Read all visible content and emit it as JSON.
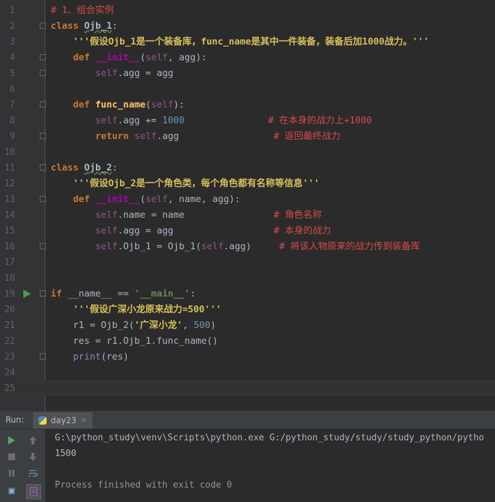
{
  "editor": {
    "lines": [
      {
        "n": "1",
        "html": "<span class='cm'># 1、组合实例</span>"
      },
      {
        "n": "2",
        "html": "<span class='kw'>class</span> <span class='cls'>Ojb_1</span>:"
      },
      {
        "n": "3",
        "html": "    <span class='docstr'>'''假设Ojb_1是一个装备库，func_name是其中一件装备，装备后加1000战力。'''</span>"
      },
      {
        "n": "4",
        "html": "    <span class='kw'>def</span> <span class='dunder'>__init__</span>(<span class='self'>self</span>, agg):"
      },
      {
        "n": "5",
        "html": "        <span class='self'>self</span>.agg = agg"
      },
      {
        "n": "6",
        "html": ""
      },
      {
        "n": "7",
        "html": "    <span class='kw'>def</span> <span class='fn'>func_name</span>(<span class='self'>self</span>):"
      },
      {
        "n": "8",
        "html": "        <span class='self'>self</span>.agg += <span class='num'>1000</span>               <span class='cm'># 在本身的战力上+1000</span>"
      },
      {
        "n": "9",
        "html": "        <span class='kw'>return</span> <span class='self'>self</span>.agg                 <span class='cm'># 返回最终战力</span>"
      },
      {
        "n": "10",
        "html": ""
      },
      {
        "n": "11",
        "html": "<span class='kw'>class</span> <span class='cls'>Ojb_2</span>:"
      },
      {
        "n": "12",
        "html": "    <span class='docstr'>'''假设Ojb_2是一个角色类，每个角色都有名称等信息'''</span>"
      },
      {
        "n": "13",
        "html": "    <span class='kw'>def</span> <span class='dunder'>__init__</span>(<span class='self'>self</span>, name, agg):"
      },
      {
        "n": "14",
        "html": "        <span class='self'>self</span>.name = name                <span class='cm'># 角色名称</span>"
      },
      {
        "n": "15",
        "html": "        <span class='self'>self</span>.agg = agg                  <span class='cm'># 本身的战力</span>"
      },
      {
        "n": "16",
        "html": "        <span class='self'>self</span>.Ojb_1 = Ojb_1(<span class='self'>self</span>.agg)     <span class='cm'># 将该人物原来的战力传到装备库</span>"
      },
      {
        "n": "17",
        "html": ""
      },
      {
        "n": "18",
        "html": ""
      },
      {
        "n": "19",
        "html": "<span class='kw'>if</span> __name__ == <span class='str'>'__main__'</span>:"
      },
      {
        "n": "20",
        "html": "    <span class='docstr'>'''假设广深小龙原来战力=500'''</span>"
      },
      {
        "n": "21",
        "html": "    r1 = Ojb_2(<span class='docstr'>'广深小龙'</span>, <span class='num'>500</span>)"
      },
      {
        "n": "22",
        "html": "    res = r1.Ojb_1.func_name()"
      },
      {
        "n": "23",
        "html": "    <span class='kw' style='font-weight:normal;color:#8888c6'>print</span>(res)"
      },
      {
        "n": "24",
        "html": ""
      },
      {
        "n": "25",
        "html": ""
      }
    ]
  },
  "run": {
    "label": "Run:",
    "tab_name": "day23",
    "close": "×",
    "command": "G:\\python_study\\venv\\Scripts\\python.exe G:/python_study/study/study_python/pytho",
    "output": "1500",
    "exit": "Process finished with exit code 0"
  }
}
